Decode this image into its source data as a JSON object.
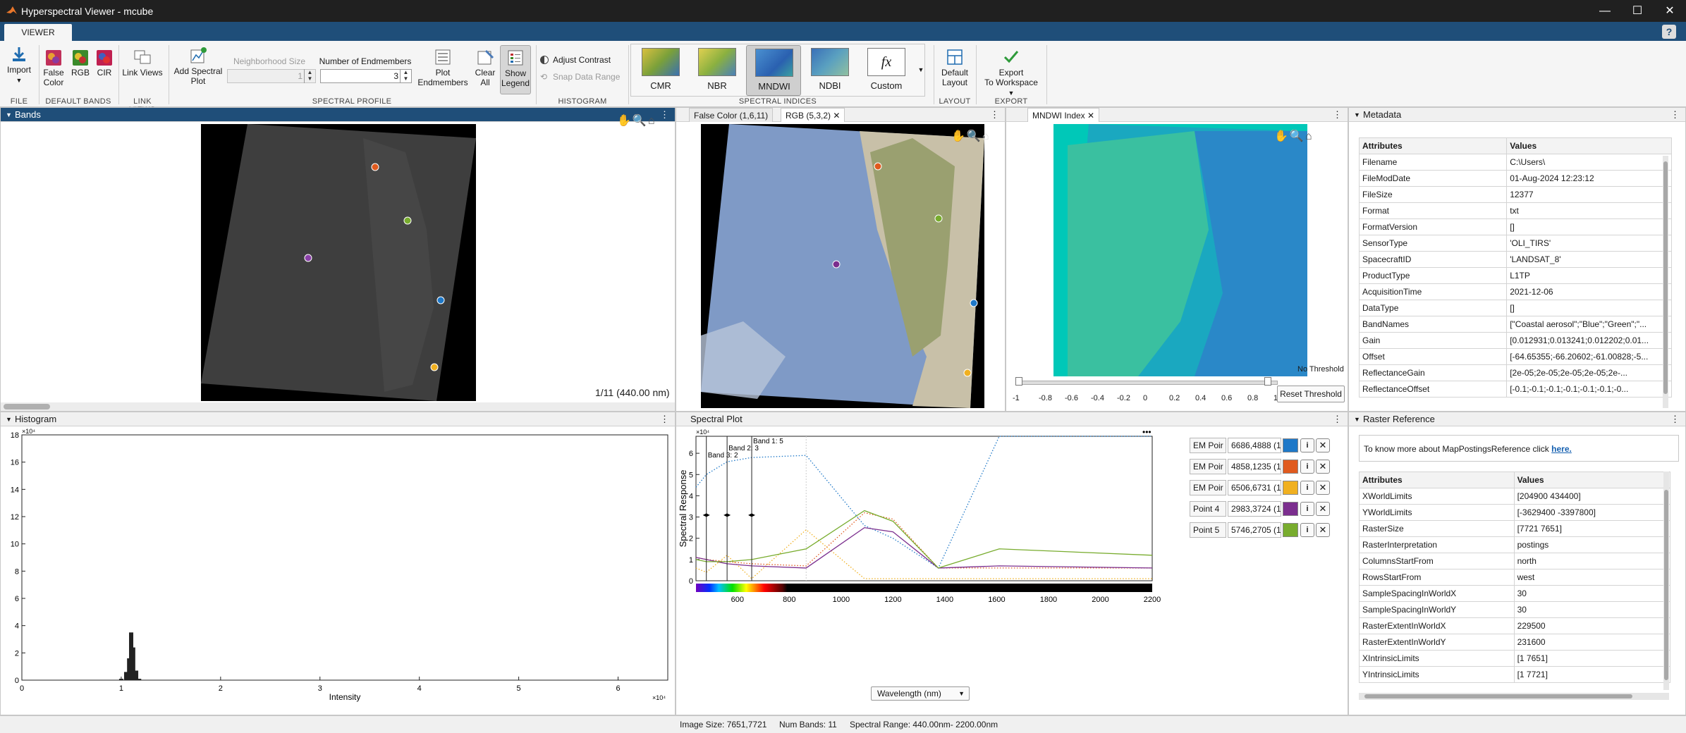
{
  "window": {
    "title": "Hyperspectral Viewer - mcube",
    "minimize": "—",
    "maximize": "☐",
    "close": "✕"
  },
  "tab": {
    "viewer": "VIEWER",
    "help": "?"
  },
  "ribbon": {
    "file": {
      "import_label": "Import",
      "section": "FILE"
    },
    "default_bands": {
      "false_color": "False",
      "false_color2": "Color",
      "rgb": "RGB",
      "cir": "CIR",
      "section": "DEFAULT BANDS"
    },
    "link_views": {
      "label": "Link Views",
      "section": "LINK VIEWS"
    },
    "spectral_profile": {
      "add_plot": "Add Spectral",
      "add_plot2": "Plot",
      "neighborhood_label": "Neighborhood Size",
      "neighborhood_value": "1",
      "endmembers_label": "Number of Endmembers",
      "endmembers_value": "3",
      "plot_endmembers": "Plot",
      "plot_endmembers2": "Endmembers",
      "clear_all": "Clear",
      "clear_all2": "All",
      "show_legend": "Show",
      "show_legend2": "Legend",
      "section": "SPECTRAL PROFILE"
    },
    "histogram": {
      "adjust_contrast": "Adjust Contrast",
      "snap_data_range": "Snap Data Range",
      "section": "HISTOGRAM"
    },
    "spectral_indices": {
      "items": [
        "CMR",
        "NBR",
        "MNDWI",
        "NDBI",
        "Custom"
      ],
      "section": "SPECTRAL INDICES",
      "custom_glyph": "fx"
    },
    "layout": {
      "default": "Default",
      "default2": "Layout",
      "section": "LAYOUT"
    },
    "export": {
      "label": "Export",
      "label2": "To Workspace",
      "section": "EXPORT"
    }
  },
  "bands_panel": {
    "title": "Bands",
    "band_readout": "1/11 (440.00 nm)"
  },
  "views": {
    "tab1": "False Color (1,6,11)",
    "tab2": "RGB (5,3,2)",
    "tab3": "MNDWI Index"
  },
  "mndwi": {
    "no_threshold": "No Threshold",
    "reset_threshold": "Reset Threshold",
    "ticks": [
      "-1",
      "-0.8",
      "-0.6",
      "-0.4",
      "-0.2",
      "0",
      "0.2",
      "0.4",
      "0.6",
      "0.8",
      "1"
    ]
  },
  "histogram_panel": {
    "title": "Histogram",
    "xlabel": "Intensity",
    "y_ticks": [
      "0",
      "2",
      "4",
      "6",
      "8",
      "10",
      "12",
      "14",
      "16",
      "18"
    ],
    "x_ticks": [
      "0",
      "1",
      "2",
      "3",
      "4",
      "5",
      "6"
    ],
    "y_exp": "×10⁴",
    "x_exp": "×10⁴"
  },
  "spectral_plot": {
    "title": "Spectral Plot",
    "ylabel": "Spectral Response",
    "xlabel": "Wavelength (nm)",
    "y_exp": "×10⁴",
    "band_labels": [
      "Band 1: 5",
      "Band 2: 3",
      "Band 3: 2"
    ]
  },
  "endmembers": [
    {
      "name": "EM Poir",
      "coord": "6686,4888 (1",
      "color": "#1e78c8"
    },
    {
      "name": "EM Poir",
      "coord": "4858,1235 (1",
      "color": "#e05a1e"
    },
    {
      "name": "EM Poir",
      "coord": "6506,6731 (1",
      "color": "#f0b020"
    },
    {
      "name": "Point 4",
      "coord": "2983,3724 (1",
      "color": "#7b2e8e"
    },
    {
      "name": "Point 5",
      "coord": "5746,2705 (1",
      "color": "#78ac2e"
    }
  ],
  "metadata": {
    "title": "Metadata",
    "col1": "Attributes",
    "col2": "Values",
    "rows": [
      [
        "Filename",
        "C:\\Users\\"
      ],
      [
        "FileModDate",
        "01-Aug-2024 12:23:12"
      ],
      [
        "FileSize",
        "12377"
      ],
      [
        "Format",
        "txt"
      ],
      [
        "FormatVersion",
        "[]"
      ],
      [
        "SensorType",
        "'OLI_TIRS'"
      ],
      [
        "SpacecraftID",
        "'LANDSAT_8'"
      ],
      [
        "ProductType",
        "L1TP"
      ],
      [
        "AcquisitionTime",
        "2021-12-06"
      ],
      [
        "DataType",
        "[]"
      ],
      [
        "BandNames",
        "[\"Coastal aerosol\";\"Blue\";\"Green\";\"..."
      ],
      [
        "Gain",
        "[0.012931;0.013241;0.012202;0.01..."
      ],
      [
        "Offset",
        "[-64.65355;-66.20602;-61.00828;-5..."
      ],
      [
        "ReflectanceGain",
        "[2e-05;2e-05;2e-05;2e-05;2e-..."
      ],
      [
        "ReflectanceOffset",
        "[-0.1;-0.1;-0.1;-0.1;-0.1;-0.1;-0..."
      ]
    ]
  },
  "raster": {
    "title": "Raster Reference",
    "info": "To know more about MapPostingsReference click",
    "link": "here.",
    "col1": "Attributes",
    "col2": "Values",
    "rows": [
      [
        "XWorldLimits",
        "[204900 434400]"
      ],
      [
        "YWorldLimits",
        "[-3629400 -3397800]"
      ],
      [
        "RasterSize",
        "[7721 7651]"
      ],
      [
        "RasterInterpretation",
        "postings"
      ],
      [
        "ColumnsStartFrom",
        "north"
      ],
      [
        "RowsStartFrom",
        "west"
      ],
      [
        "SampleSpacingInWorldX",
        "30"
      ],
      [
        "SampleSpacingInWorldY",
        "30"
      ],
      [
        "RasterExtentInWorldX",
        "229500"
      ],
      [
        "RasterExtentInWorldY",
        "231600"
      ],
      [
        "XIntrinsicLimits",
        "[1 7651]"
      ],
      [
        "YIntrinsicLimits",
        "[1 7721]"
      ]
    ]
  },
  "status": {
    "image_size": "Image Size: 7651,7721",
    "num_bands": "Num Bands: 11",
    "spectral_range": "Spectral Range: 440.00nm- 2200.00nm"
  },
  "chart_data": [
    {
      "type": "bar",
      "title": "",
      "xlabel": "Intensity",
      "ylabel": "",
      "x": [
        1.0,
        1.05,
        1.08,
        1.1,
        1.12,
        1.15,
        1.18
      ],
      "values": [
        0.1,
        0.6,
        1.6,
        3.5,
        2.4,
        0.7,
        0.1
      ],
      "xlim": [
        0,
        6.5
      ],
      "ylim": [
        0,
        18
      ],
      "grid": false
    },
    {
      "type": "line",
      "title": "",
      "xlabel": "Wavelength (nm)",
      "ylabel": "Spectral Response",
      "x": [
        440,
        480,
        560,
        655,
        865,
        1090,
        1200,
        1375,
        1610,
        2200
      ],
      "x_ticks": [
        600,
        800,
        1000,
        1200,
        1400,
        1600,
        1800,
        2000,
        2200
      ],
      "xlim": [
        440,
        2200
      ],
      "ylim": [
        0,
        6.8
      ],
      "y_ticks": [
        0,
        1,
        2,
        3,
        4,
        5,
        6
      ],
      "series": [
        {
          "color": "#1e78c8",
          "style": "dotted",
          "values": [
            4.4,
            5.0,
            5.6,
            5.8,
            5.9,
            2.6,
            2.0,
            0.6,
            6.8,
            6.8
          ]
        },
        {
          "color": "#e05a1e",
          "style": "dotted",
          "values": [
            1.1,
            1.0,
            0.9,
            0.8,
            0.7,
            3.2,
            2.9,
            0.6,
            0.6,
            0.6
          ]
        },
        {
          "color": "#f0b020",
          "style": "dotted",
          "values": [
            0.6,
            0.4,
            1.2,
            0.1,
            2.4,
            0.1,
            0.1,
            0.1,
            0.1,
            0.1
          ]
        },
        {
          "color": "#7b2e8e",
          "style": "solid",
          "values": [
            1.1,
            1.0,
            0.8,
            0.7,
            0.6,
            2.5,
            2.3,
            0.6,
            0.7,
            0.6
          ]
        },
        {
          "color": "#78ac2e",
          "style": "solid",
          "values": [
            1.0,
            0.9,
            0.9,
            1.0,
            1.5,
            3.3,
            2.8,
            0.6,
            1.5,
            1.2
          ]
        }
      ],
      "band_markers": [
        480,
        560,
        655
      ]
    }
  ]
}
